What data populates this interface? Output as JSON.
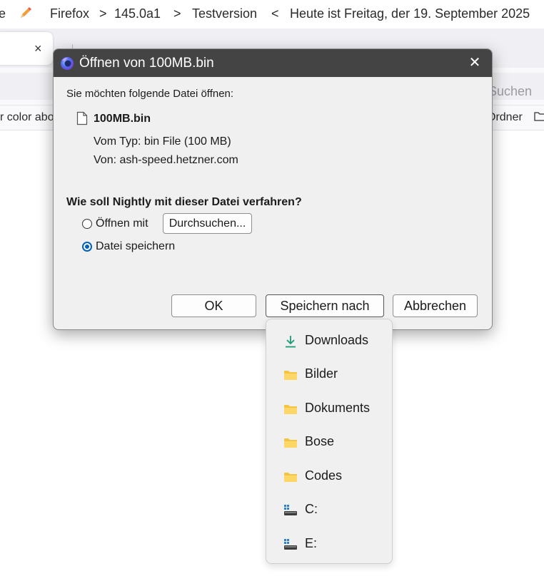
{
  "topbar": {
    "left_fragment": "e",
    "crumb1": "Firefox",
    "sep1": ">",
    "crumb2": "145.0a1",
    "sep2": ">",
    "crumb3": "Testversion",
    "sep3": "<",
    "date_text": "Heute ist Freitag, der 19. September 2025"
  },
  "tab": {
    "close_glyph": "×"
  },
  "navbar": {
    "search_fragment": "Suchen"
  },
  "bookmarks": {
    "left_fragment": "r color abo",
    "right_fragment": "Ordner"
  },
  "dialog": {
    "title": "Öffnen von 100MB.bin",
    "close_glyph": "✕",
    "intro": "Sie möchten folgende Datei öffnen:",
    "file_name": "100MB.bin",
    "type_line": "Vom Typ: bin File (100 MB)",
    "source_line": "Von: ash-speed.hetzner.com",
    "question": "Wie soll Nightly mit dieser Datei verfahren?",
    "option_open": {
      "label": "Öffnen mit",
      "selected": false
    },
    "browse_button": "Durchsuchen...",
    "option_save": {
      "label": "Datei speichern",
      "selected": true
    },
    "ok_button": "OK",
    "save_to_button": "Speichern nach",
    "cancel_button": "Abbrechen"
  },
  "save_menu": {
    "items": [
      {
        "label": "Downloads",
        "icon": "download-icon"
      },
      {
        "label": "Bilder",
        "icon": "folder-icon"
      },
      {
        "label": "Dokuments",
        "icon": "folder-icon"
      },
      {
        "label": "Bose",
        "icon": "folder-icon"
      },
      {
        "label": "Codes",
        "icon": "folder-icon"
      },
      {
        "label": "C:",
        "icon": "drive-icon"
      },
      {
        "label": "E:",
        "icon": "drive-icon"
      }
    ]
  },
  "colors": {
    "titlebar": "#444444",
    "dialog_bg": "#f0f0f0",
    "accent": "#005fb8",
    "folder": "#f4c542",
    "download_green": "#1a9c74"
  }
}
